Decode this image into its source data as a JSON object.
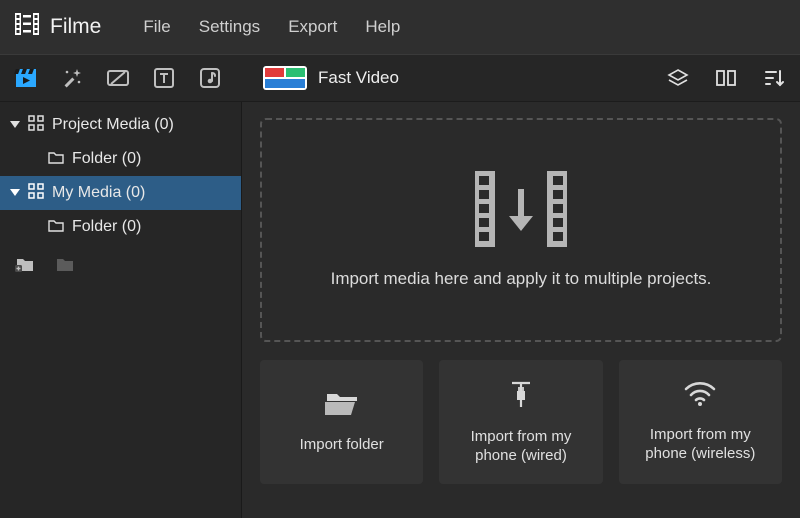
{
  "app": {
    "name": "Filme"
  },
  "menu": {
    "file": "File",
    "settings": "Settings",
    "export": "Export",
    "help": "Help"
  },
  "toolbar": {
    "fastvideo": "Fast Video"
  },
  "sidebar": {
    "project_media": "Project Media (0)",
    "project_folder": "Folder (0)",
    "my_media": "My Media (0)",
    "my_folder": "Folder (0)"
  },
  "dropzone": {
    "hint": "Import media here and apply it to multiple projects."
  },
  "cards": {
    "import_folder": "Import folder",
    "phone_wired": "Import from my phone (wired)",
    "phone_wireless": "Import from my phone (wireless)"
  }
}
